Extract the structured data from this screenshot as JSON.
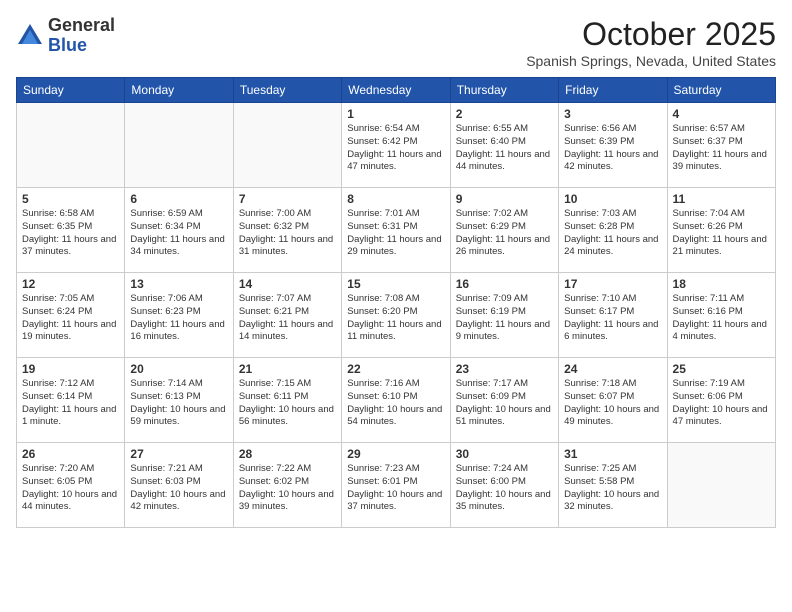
{
  "header": {
    "logo_general": "General",
    "logo_blue": "Blue",
    "month": "October 2025",
    "location": "Spanish Springs, Nevada, United States"
  },
  "weekdays": [
    "Sunday",
    "Monday",
    "Tuesday",
    "Wednesday",
    "Thursday",
    "Friday",
    "Saturday"
  ],
  "weeks": [
    [
      {
        "day": "",
        "text": ""
      },
      {
        "day": "",
        "text": ""
      },
      {
        "day": "",
        "text": ""
      },
      {
        "day": "1",
        "text": "Sunrise: 6:54 AM\nSunset: 6:42 PM\nDaylight: 11 hours and 47 minutes."
      },
      {
        "day": "2",
        "text": "Sunrise: 6:55 AM\nSunset: 6:40 PM\nDaylight: 11 hours and 44 minutes."
      },
      {
        "day": "3",
        "text": "Sunrise: 6:56 AM\nSunset: 6:39 PM\nDaylight: 11 hours and 42 minutes."
      },
      {
        "day": "4",
        "text": "Sunrise: 6:57 AM\nSunset: 6:37 PM\nDaylight: 11 hours and 39 minutes."
      }
    ],
    [
      {
        "day": "5",
        "text": "Sunrise: 6:58 AM\nSunset: 6:35 PM\nDaylight: 11 hours and 37 minutes."
      },
      {
        "day": "6",
        "text": "Sunrise: 6:59 AM\nSunset: 6:34 PM\nDaylight: 11 hours and 34 minutes."
      },
      {
        "day": "7",
        "text": "Sunrise: 7:00 AM\nSunset: 6:32 PM\nDaylight: 11 hours and 31 minutes."
      },
      {
        "day": "8",
        "text": "Sunrise: 7:01 AM\nSunset: 6:31 PM\nDaylight: 11 hours and 29 minutes."
      },
      {
        "day": "9",
        "text": "Sunrise: 7:02 AM\nSunset: 6:29 PM\nDaylight: 11 hours and 26 minutes."
      },
      {
        "day": "10",
        "text": "Sunrise: 7:03 AM\nSunset: 6:28 PM\nDaylight: 11 hours and 24 minutes."
      },
      {
        "day": "11",
        "text": "Sunrise: 7:04 AM\nSunset: 6:26 PM\nDaylight: 11 hours and 21 minutes."
      }
    ],
    [
      {
        "day": "12",
        "text": "Sunrise: 7:05 AM\nSunset: 6:24 PM\nDaylight: 11 hours and 19 minutes."
      },
      {
        "day": "13",
        "text": "Sunrise: 7:06 AM\nSunset: 6:23 PM\nDaylight: 11 hours and 16 minutes."
      },
      {
        "day": "14",
        "text": "Sunrise: 7:07 AM\nSunset: 6:21 PM\nDaylight: 11 hours and 14 minutes."
      },
      {
        "day": "15",
        "text": "Sunrise: 7:08 AM\nSunset: 6:20 PM\nDaylight: 11 hours and 11 minutes."
      },
      {
        "day": "16",
        "text": "Sunrise: 7:09 AM\nSunset: 6:19 PM\nDaylight: 11 hours and 9 minutes."
      },
      {
        "day": "17",
        "text": "Sunrise: 7:10 AM\nSunset: 6:17 PM\nDaylight: 11 hours and 6 minutes."
      },
      {
        "day": "18",
        "text": "Sunrise: 7:11 AM\nSunset: 6:16 PM\nDaylight: 11 hours and 4 minutes."
      }
    ],
    [
      {
        "day": "19",
        "text": "Sunrise: 7:12 AM\nSunset: 6:14 PM\nDaylight: 11 hours and 1 minute."
      },
      {
        "day": "20",
        "text": "Sunrise: 7:14 AM\nSunset: 6:13 PM\nDaylight: 10 hours and 59 minutes."
      },
      {
        "day": "21",
        "text": "Sunrise: 7:15 AM\nSunset: 6:11 PM\nDaylight: 10 hours and 56 minutes."
      },
      {
        "day": "22",
        "text": "Sunrise: 7:16 AM\nSunset: 6:10 PM\nDaylight: 10 hours and 54 minutes."
      },
      {
        "day": "23",
        "text": "Sunrise: 7:17 AM\nSunset: 6:09 PM\nDaylight: 10 hours and 51 minutes."
      },
      {
        "day": "24",
        "text": "Sunrise: 7:18 AM\nSunset: 6:07 PM\nDaylight: 10 hours and 49 minutes."
      },
      {
        "day": "25",
        "text": "Sunrise: 7:19 AM\nSunset: 6:06 PM\nDaylight: 10 hours and 47 minutes."
      }
    ],
    [
      {
        "day": "26",
        "text": "Sunrise: 7:20 AM\nSunset: 6:05 PM\nDaylight: 10 hours and 44 minutes."
      },
      {
        "day": "27",
        "text": "Sunrise: 7:21 AM\nSunset: 6:03 PM\nDaylight: 10 hours and 42 minutes."
      },
      {
        "day": "28",
        "text": "Sunrise: 7:22 AM\nSunset: 6:02 PM\nDaylight: 10 hours and 39 minutes."
      },
      {
        "day": "29",
        "text": "Sunrise: 7:23 AM\nSunset: 6:01 PM\nDaylight: 10 hours and 37 minutes."
      },
      {
        "day": "30",
        "text": "Sunrise: 7:24 AM\nSunset: 6:00 PM\nDaylight: 10 hours and 35 minutes."
      },
      {
        "day": "31",
        "text": "Sunrise: 7:25 AM\nSunset: 5:58 PM\nDaylight: 10 hours and 32 minutes."
      },
      {
        "day": "",
        "text": ""
      }
    ]
  ]
}
